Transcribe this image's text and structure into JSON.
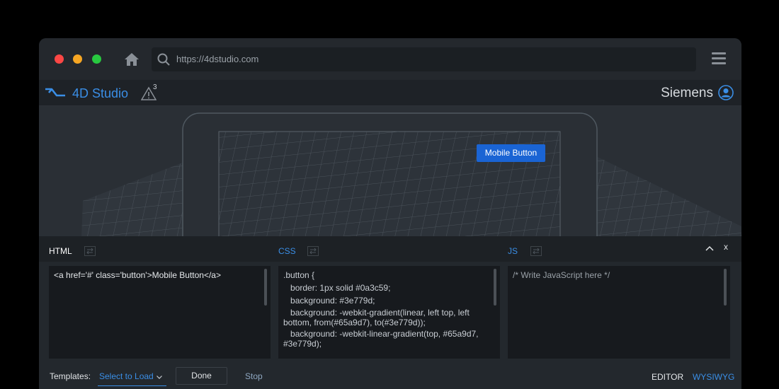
{
  "browser": {
    "url": "https://4dstudio.com"
  },
  "app": {
    "brand": "4D Studio",
    "warning_count": "3",
    "user_name": "Siemens",
    "accent": "#3a8ee6"
  },
  "preview": {
    "mobile_button_label": "Mobile Button",
    "button_color": "#1a64d4"
  },
  "editor": {
    "tabs": [
      {
        "label": "HTML"
      },
      {
        "label": "CSS"
      },
      {
        "label": "JS"
      }
    ],
    "close_label": "x",
    "html_code": [
      "<a href='#' class='button'>Mobile Button</a>"
    ],
    "css_code": [
      ".button {",
      "   border: 1px solid #0a3c59;",
      "   background: #3e779d;",
      "   background: -webkit-gradient(linear, left top, left bottom, from(#65a9d7), to(#3e779d));",
      "   background: -webkit-linear-gradient(top, #65a9d7, #3e779d);"
    ],
    "js_code": [
      "/* Write JavaScript here */"
    ]
  },
  "footer": {
    "templates_label": "Templates:",
    "templates_select": "Select to Load",
    "done_label": "Done",
    "stop_label": "Stop",
    "mode_editor": "EDITOR",
    "mode_wysiwyg": "WYSIWYG"
  }
}
